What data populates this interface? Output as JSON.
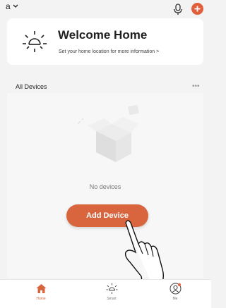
{
  "header": {
    "home_name": "a",
    "chevron_icon": "chevron-down-icon",
    "mic_icon": "microphone-icon",
    "add_icon": "plus-icon",
    "accent": "#e0603c"
  },
  "welcome": {
    "title": "Welcome Home",
    "subtitle": "Set your home location for more information >",
    "icon": "sun-icon"
  },
  "devices": {
    "section_title": "All Devices",
    "more": "•••",
    "empty_text": "No devices",
    "add_button": "Add Device",
    "button_color": "#d9653f"
  },
  "tabbar": {
    "tabs": [
      {
        "label": "Home",
        "icon": "home-icon",
        "active": true
      },
      {
        "label": "Smart",
        "icon": "sun-icon",
        "active": false
      },
      {
        "label": "Me",
        "icon": "profile-icon",
        "active": false
      }
    ]
  }
}
